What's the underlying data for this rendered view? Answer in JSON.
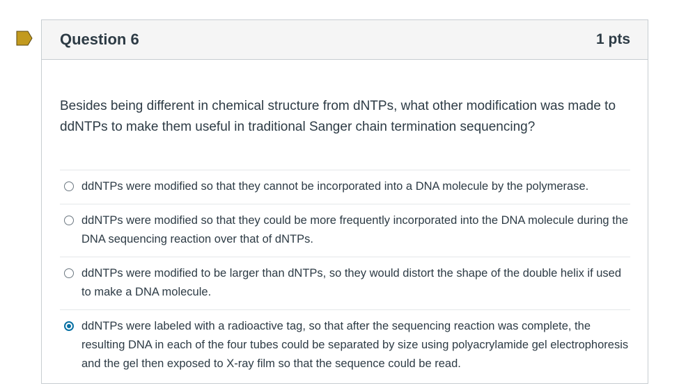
{
  "question": {
    "title": "Question 6",
    "points": "1 pts",
    "text": "Besides being different in chemical structure from dNTPs, what other modification was made to ddNTPs to make them useful in traditional Sanger chain termination sequencing?",
    "selected_index": 3,
    "answers": [
      {
        "label": "ddNTPs were modified so that they cannot be incorporated into a DNA molecule by the polymerase."
      },
      {
        "label": "ddNTPs were modified so that they could be more frequently incorporated into the DNA molecule during the DNA sequencing reaction over that of dNTPs."
      },
      {
        "label": "ddNTPs were modified to be larger than dNTPs, so they would distort the shape of the double helix if used to make a DNA molecule."
      },
      {
        "label": "ddNTPs were labeled with a radioactive tag, so that after the sequencing reaction was complete, the resulting DNA in each of the four tubes could be separated by size using polyacrylamide gel electrophoresis and the gel then exposed to X-ray film so that the sequence could be read."
      }
    ]
  },
  "colors": {
    "flag": "#c29a1f",
    "radio_selected": "#0770a3"
  },
  "icons": {
    "flag": "flag-icon"
  }
}
